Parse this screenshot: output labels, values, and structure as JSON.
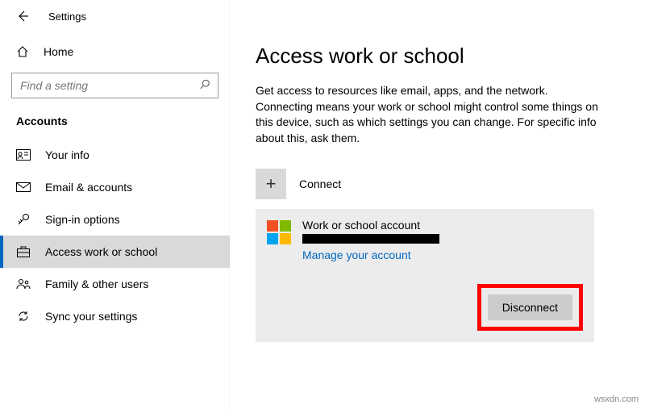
{
  "app_title": "Settings",
  "home_label": "Home",
  "search_placeholder": "Find a setting",
  "section_header": "Accounts",
  "nav": [
    {
      "label": "Your info"
    },
    {
      "label": "Email & accounts"
    },
    {
      "label": "Sign-in options"
    },
    {
      "label": "Access work or school"
    },
    {
      "label": "Family & other users"
    },
    {
      "label": "Sync your settings"
    }
  ],
  "page": {
    "title": "Access work or school",
    "description": "Get access to resources like email, apps, and the network. Connecting means your work or school might control some things on this device, such as which settings you can change. For specific info about this, ask them.",
    "connect_label": "Connect",
    "plus_glyph": "+"
  },
  "account": {
    "title": "Work or school account",
    "manage_link": "Manage your account",
    "disconnect_label": "Disconnect"
  },
  "watermark": "wsxdn.com"
}
